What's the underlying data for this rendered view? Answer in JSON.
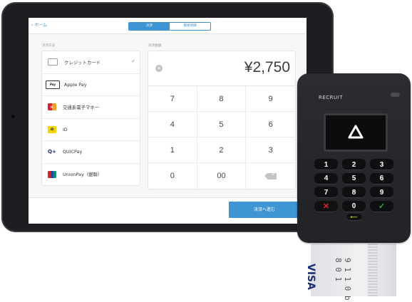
{
  "header": {
    "back_label": "ホーム",
    "tabs": [
      {
        "label": "決済",
        "active": true
      },
      {
        "label": "簡易明細",
        "active": false
      }
    ]
  },
  "payment_methods": {
    "section_label": "決済方法",
    "items": [
      {
        "label": "クレジットカード",
        "icon": "credit-card-icon",
        "selected": true
      },
      {
        "label": "Apple Pay",
        "icon": "apple-pay-icon",
        "selected": false
      },
      {
        "label": "交通系電子マネー",
        "icon": "transit-ic-icon",
        "selected": false
      },
      {
        "label": "iD",
        "icon": "id-icon",
        "selected": false
      },
      {
        "label": "QUICPay",
        "icon": "quicpay-icon",
        "selected": false
      },
      {
        "label": "UnionPay（銀聯）",
        "icon": "unionpay-icon",
        "selected": false
      }
    ]
  },
  "amount": {
    "section_label": "決済金額",
    "value": "¥2,750"
  },
  "keypad": {
    "keys": [
      "7",
      "8",
      "9",
      "4",
      "5",
      "6",
      "1",
      "2",
      "3",
      "0",
      "00"
    ]
  },
  "footer": {
    "proceed_label": "決済へ進む"
  },
  "reader": {
    "brand": "RECRUIT",
    "keys": [
      "1",
      "2",
      "3",
      "4",
      "5",
      "6",
      "7",
      "8",
      "9",
      "0"
    ]
  },
  "card": {
    "brand": "VISA",
    "number_fragment": "9 1 1 0 b 8 0 1"
  },
  "colors": {
    "accent": "#3e95d4",
    "tablet_frame": "#1d1e21",
    "reader_body": "#2b2c30"
  }
}
